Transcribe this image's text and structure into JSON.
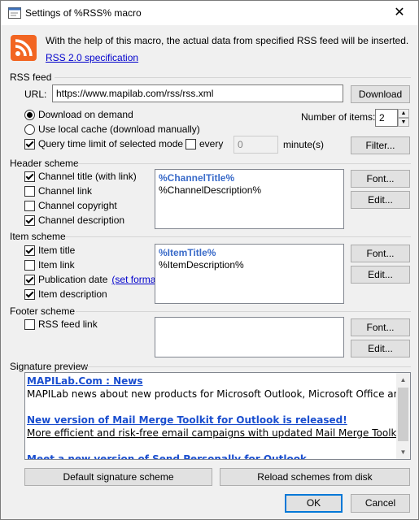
{
  "window": {
    "title": "Settings of %RSS% macro",
    "close_glyph": "✕"
  },
  "intro": {
    "text": "With the help of this macro, the actual data from specified RSS feed will be inserted.",
    "spec_link": "RSS 2.0 specification"
  },
  "rss_feed": {
    "group_label": "RSS feed",
    "url_label": "URL:",
    "url_value": "https://www.mapilab.com/rss/rss.xml",
    "download_button": "Download",
    "mode_download": "Download on demand",
    "mode_cache": "Use local cache (download manually)",
    "number_label": "Number of items:",
    "number_value": "2",
    "query_limit_label": "Query time limit of selected mode",
    "every_label": "every",
    "every_value": "0",
    "minutes_label": "minute(s)",
    "filter_button": "Filter..."
  },
  "header_scheme": {
    "group_label": "Header scheme",
    "channel_title": "Channel title (with link)",
    "channel_link": "Channel link",
    "channel_copyright": "Channel copyright",
    "channel_description": "Channel description",
    "line1": "%ChannelTitle%",
    "line2": "%ChannelDescription%",
    "font_button": "Font...",
    "edit_button": "Edit..."
  },
  "item_scheme": {
    "group_label": "Item scheme",
    "item_title": "Item title",
    "item_link": "Item link",
    "publication_date": "Publication date",
    "set_format": "(set format)",
    "item_description": "Item description",
    "line1": "%ItemTitle%",
    "line2": "%ItemDescription%",
    "font_button": "Font...",
    "edit_button": "Edit..."
  },
  "footer_scheme": {
    "group_label": "Footer scheme",
    "rss_feed_link": "RSS feed link",
    "font_button": "Font...",
    "edit_button": "Edit..."
  },
  "signature_preview": {
    "group_label": "Signature preview",
    "lines": [
      "MAPILab.Com : News",
      "MAPILab news about new products for Microsoft Outlook, Microsoft Office and Mic",
      "",
      "New version of Mail Merge Toolkit for Outlook is released!",
      "More efficient and risk-free email campaigns with updated Mail Merge Toolkit: bat",
      "",
      "Meet a new version of Send Personally for Outlook"
    ]
  },
  "buttons": {
    "default_scheme": "Default signature scheme",
    "reload_schemes": "Reload schemes from disk",
    "ok": "OK",
    "cancel": "Cancel"
  },
  "colors": {
    "rss_orange": "#f26522",
    "link_blue": "#0000cc",
    "accent_blue": "#0078d7"
  }
}
